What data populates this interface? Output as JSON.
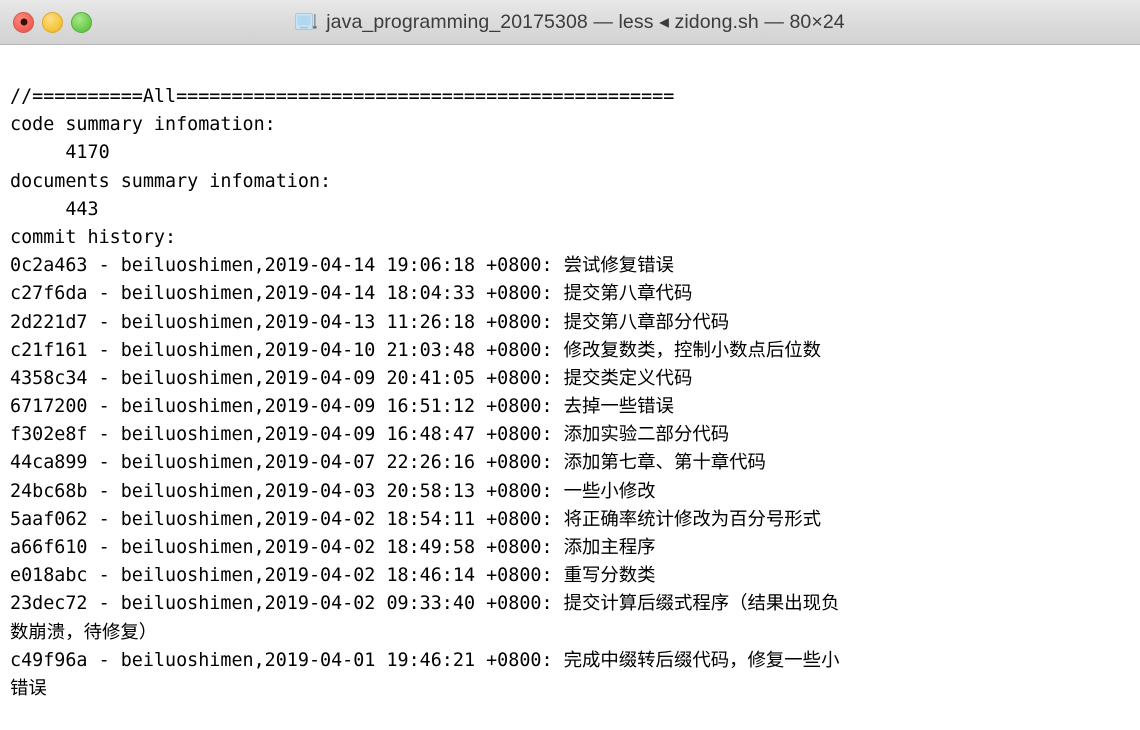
{
  "window": {
    "title": "java_programming_20175308 — less ◂ zidong.sh — 80×24",
    "icon": "terminal-document-icon",
    "controls": {
      "close_label": "",
      "minimize_label": "",
      "maximize_label": ""
    },
    "colors": {
      "close": "#f4675c",
      "minimize": "#f5c63f",
      "maximize": "#6fce52",
      "titlebar_bg": "#dcdcdc",
      "terminal_bg": "#ffffff",
      "terminal_fg": "#000000"
    }
  },
  "terminal": {
    "columns": 80,
    "rows": 24,
    "program": "less",
    "script": "zidong.sh",
    "lines": [
      "//==========All=============================================",
      "code summary infomation:",
      "     4170",
      "documents summary infomation:",
      "     443",
      "commit history:",
      "0c2a463 - beiluoshimen,2019-04-14 19:06:18 +0800: 尝试修复错误",
      "c27f6da - beiluoshimen,2019-04-14 18:04:33 +0800: 提交第八章代码",
      "2d221d7 - beiluoshimen,2019-04-13 11:26:18 +0800: 提交第八章部分代码",
      "c21f161 - beiluoshimen,2019-04-10 21:03:48 +0800: 修改复数类，控制小数点后位数",
      "4358c34 - beiluoshimen,2019-04-09 20:41:05 +0800: 提交类定义代码",
      "6717200 - beiluoshimen,2019-04-09 16:51:12 +0800: 去掉一些错误",
      "f302e8f - beiluoshimen,2019-04-09 16:48:47 +0800: 添加实验二部分代码",
      "44ca899 - beiluoshimen,2019-04-07 22:26:16 +0800: 添加第七章、第十章代码",
      "24bc68b - beiluoshimen,2019-04-03 20:58:13 +0800: 一些小修改",
      "5aaf062 - beiluoshimen,2019-04-02 18:54:11 +0800: 将正确率统计修改为百分号形式",
      "a66f610 - beiluoshimen,2019-04-02 18:49:58 +0800: 添加主程序",
      "e018abc - beiluoshimen,2019-04-02 18:46:14 +0800: 重写分数类",
      "23dec72 - beiluoshimen,2019-04-02 09:33:40 +0800: 提交计算后缀式程序（结果出现负",
      "数崩溃，待修复）",
      "c49f96a - beiluoshimen,2019-04-01 19:46:21 +0800: 完成中缀转后缀代码，修复一些小",
      "错误"
    ],
    "commits": [
      {
        "hash": "0c2a463",
        "author": "beiluoshimen",
        "date": "2019-04-14",
        "time": "19:06:18",
        "tz": "+0800",
        "message": "尝试修复错误"
      },
      {
        "hash": "c27f6da",
        "author": "beiluoshimen",
        "date": "2019-04-14",
        "time": "18:04:33",
        "tz": "+0800",
        "message": "提交第八章代码"
      },
      {
        "hash": "2d221d7",
        "author": "beiluoshimen",
        "date": "2019-04-13",
        "time": "11:26:18",
        "tz": "+0800",
        "message": "提交第八章部分代码"
      },
      {
        "hash": "c21f161",
        "author": "beiluoshimen",
        "date": "2019-04-10",
        "time": "21:03:48",
        "tz": "+0800",
        "message": "修改复数类，控制小数点后位数"
      },
      {
        "hash": "4358c34",
        "author": "beiluoshimen",
        "date": "2019-04-09",
        "time": "20:41:05",
        "tz": "+0800",
        "message": "提交类定义代码"
      },
      {
        "hash": "6717200",
        "author": "beiluoshimen",
        "date": "2019-04-09",
        "time": "16:51:12",
        "tz": "+0800",
        "message": "去掉一些错误"
      },
      {
        "hash": "f302e8f",
        "author": "beiluoshimen",
        "date": "2019-04-09",
        "time": "16:48:47",
        "tz": "+0800",
        "message": "添加实验二部分代码"
      },
      {
        "hash": "44ca899",
        "author": "beiluoshimen",
        "date": "2019-04-07",
        "time": "22:26:16",
        "tz": "+0800",
        "message": "添加第七章、第十章代码"
      },
      {
        "hash": "24bc68b",
        "author": "beiluoshimen",
        "date": "2019-04-03",
        "time": "20:58:13",
        "tz": "+0800",
        "message": "一些小修改"
      },
      {
        "hash": "5aaf062",
        "author": "beiluoshimen",
        "date": "2019-04-02",
        "time": "18:54:11",
        "tz": "+0800",
        "message": "将正确率统计修改为百分号形式"
      },
      {
        "hash": "a66f610",
        "author": "beiluoshimen",
        "date": "2019-04-02",
        "time": "18:49:58",
        "tz": "+0800",
        "message": "添加主程序"
      },
      {
        "hash": "e018abc",
        "author": "beiluoshimen",
        "date": "2019-04-02",
        "time": "18:46:14",
        "tz": "+0800",
        "message": "重写分数类"
      },
      {
        "hash": "23dec72",
        "author": "beiluoshimen",
        "date": "2019-04-02",
        "time": "09:33:40",
        "tz": "+0800",
        "message": "提交计算后缀式程序（结果出现负数崩溃，待修复）"
      },
      {
        "hash": "c49f96a",
        "author": "beiluoshimen",
        "date": "2019-04-01",
        "time": "19:46:21",
        "tz": "+0800",
        "message": "完成中缀转后缀代码，修复一些小错误"
      }
    ],
    "summary": {
      "header": "//==========All=============================================",
      "code_label": "code summary infomation:",
      "code_count": "4170",
      "documents_label": "documents summary infomation:",
      "documents_count": "443",
      "commit_label": "commit history:"
    }
  }
}
